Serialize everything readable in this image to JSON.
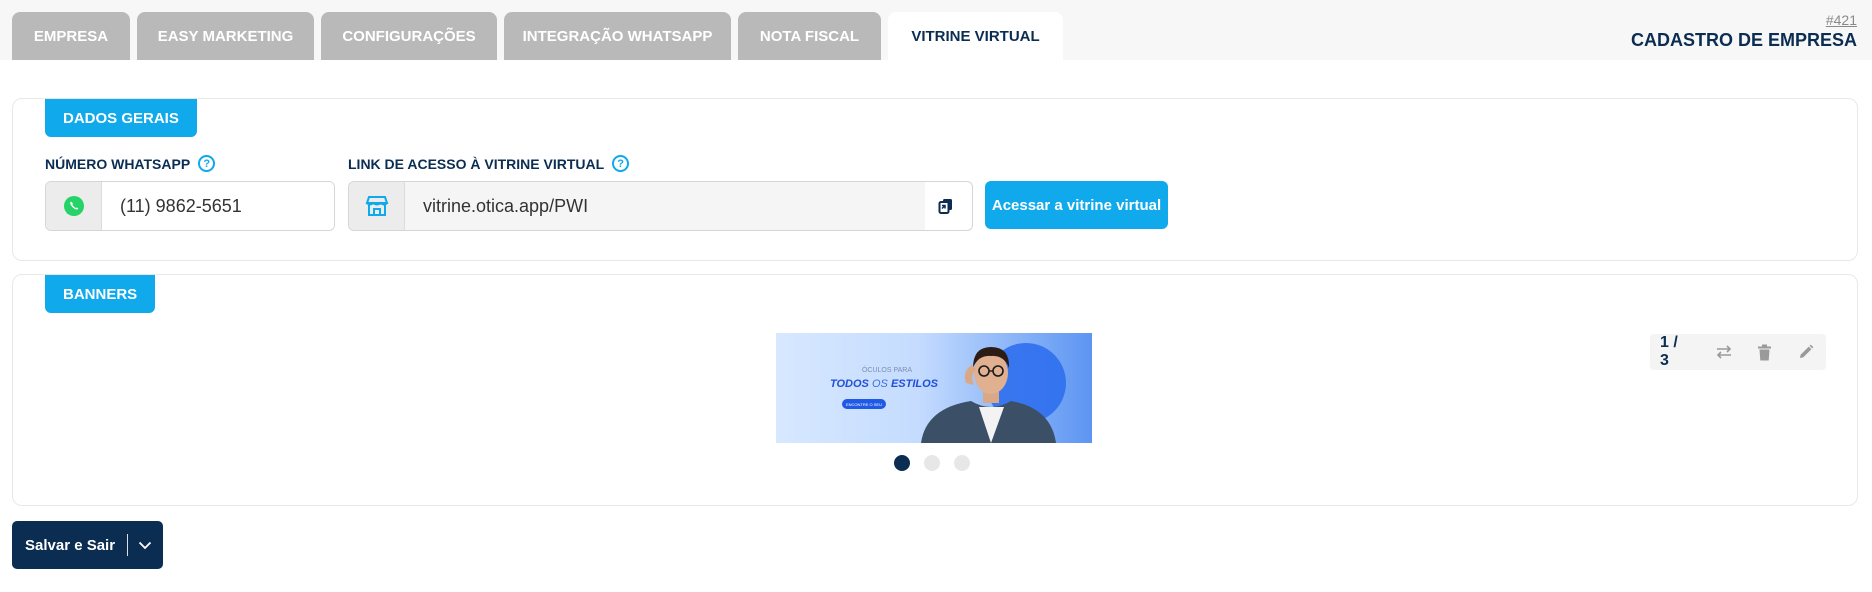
{
  "tabs": [
    {
      "label": "EMPRESA",
      "name": "tab-empresa"
    },
    {
      "label": "EASY MARKETING",
      "name": "tab-easy-marketing"
    },
    {
      "label": "CONFIGURAÇÕES",
      "name": "tab-configuracoes"
    },
    {
      "label": "INTEGRAÇÃO WHATSAPP",
      "name": "tab-integracao-whatsapp"
    },
    {
      "label": "NOTA FISCAL",
      "name": "tab-nota-fiscal"
    },
    {
      "label": "VITRINE VIRTUAL",
      "name": "tab-vitrine-virtual",
      "active": true
    }
  ],
  "header": {
    "record_id": "#421",
    "title": "CADASTRO DE EMPRESA"
  },
  "dados_gerais": {
    "section_label": "DADOS GERAIS",
    "whatsapp_label": "NÚMERO WHATSAPP",
    "whatsapp_value": "(11) 9862-5651",
    "link_label": "LINK DE ACESSO À VITRINE VIRTUAL",
    "link_value": "vitrine.otica.app/PWI",
    "access_button": "Acessar a vitrine virtual",
    "help_glyph": "?"
  },
  "banners": {
    "section_label": "BANNERS",
    "counter": "1 / 3",
    "total": 3,
    "current": 1,
    "banner_text": {
      "line1": "ÓCULOS PARA",
      "line2a": "TODOS",
      "line2b": "OS",
      "line2c": "ESTILOS",
      "cta": "ENCONTRE O SEU"
    }
  },
  "footer": {
    "save_label": "Salvar e Sair"
  },
  "colors": {
    "accent": "#0fa9ec",
    "navy": "#0b2d52",
    "tab_inactive": "#b9b9b9",
    "whatsapp": "#25d366"
  }
}
